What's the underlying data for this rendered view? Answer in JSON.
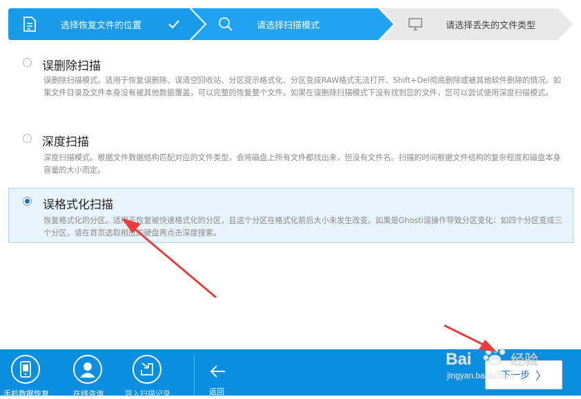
{
  "steps": [
    {
      "label": "选择恢复文件的位置",
      "icon": "document-icon",
      "status": "done"
    },
    {
      "label": "请选择扫描模式",
      "icon": "search-icon",
      "status": "active"
    },
    {
      "label": "请选择丢失的文件类型",
      "icon": "monitor-icon",
      "status": "pending"
    }
  ],
  "options": [
    {
      "title": "误删除扫描",
      "desc": "误删除扫描模式。适用于恢复误删除、误清空回收站、分区提示格式化、分区变成RAW格式无法打开、Shift+Del彻底删除或被其他软件删除的情况。如果文件目录及文件本身没有被其他数据覆盖，可以完整的恢复整个文件。如果在误删除扫描模式下没有找到您的文件，您可以尝试使用深度扫描模式。",
      "selected": false
    },
    {
      "title": "深度扫描",
      "desc": "深度扫描模式。根据文件数据结构匹配对应的文件类型，会将磁盘上所有文件都找出来，但没有文件名。扫描的时间根据文件结构的复杂程度和磁盘本身容量的大小而定。",
      "selected": false
    },
    {
      "title": "误格式化扫描",
      "desc": "恢复格式化的分区。适用于恢复被快速格式化的分区，且这个分区在格式化前后大小未发生改变。如果是Ghosti误操作导致分区变化：如四个分区变成三个分区，请在首页选取相应的硬盘再点击深度搜索。",
      "selected": true
    }
  ],
  "toolbar": {
    "tools": [
      {
        "label": "手机数据恢复",
        "icon": "phone-icon"
      },
      {
        "label": "在线咨询",
        "icon": "user-icon"
      },
      {
        "label": "导入扫描记录",
        "icon": "import-icon"
      }
    ],
    "back_label": "返回",
    "next_label": "下一步"
  },
  "watermark": {
    "text": "Bai du 经验",
    "sub": "jingyan.baidu.com"
  },
  "colors": {
    "accent": "#0a8fe0",
    "step_active": "#1fa3f2",
    "selected_bg": "#e8f4fb",
    "arrow": "#ee3b3b"
  }
}
